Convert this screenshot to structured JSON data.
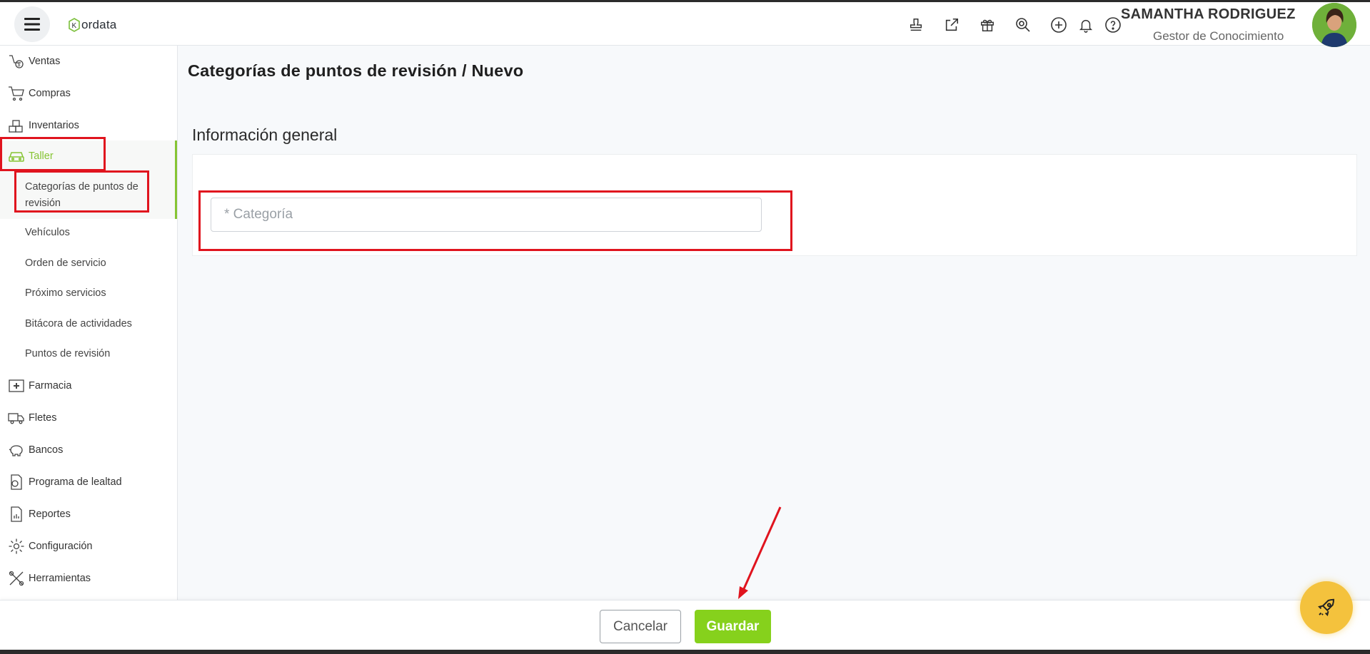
{
  "header": {
    "logo_text": "ordata",
    "logo_mark": "K",
    "icons": [
      "stamp-icon",
      "external-link-icon",
      "gift-icon",
      "search-zoom-icon",
      "plus-circle-icon",
      "bell-icon",
      "help-icon"
    ],
    "user_name": "SAMANTHA RODRIGUEZ",
    "user_role": "Gestor de Conocimiento"
  },
  "sidebar": {
    "items": [
      {
        "label": "Ventas",
        "icon": "sales-icon"
      },
      {
        "label": "Compras",
        "icon": "cart-icon"
      },
      {
        "label": "Inventarios",
        "icon": "boxes-icon"
      },
      {
        "label": "Taller",
        "icon": "car-icon"
      },
      {
        "label": "Farmacia",
        "icon": "pharmacy-icon"
      },
      {
        "label": "Fletes",
        "icon": "truck-icon"
      },
      {
        "label": "Bancos",
        "icon": "piggy-bank-icon"
      },
      {
        "label": "Programa de lealtad",
        "icon": "loyalty-icon"
      },
      {
        "label": "Reportes",
        "icon": "report-icon"
      },
      {
        "label": "Configuración",
        "icon": "gear-icon"
      },
      {
        "label": "Herramientas",
        "icon": "tools-icon"
      }
    ],
    "taller_sub": [
      "Categorías de puntos de revisión",
      "Vehículos",
      "Orden de servicio",
      "Próximo servicios",
      "Bitácora de actividades",
      "Puntos de revisión"
    ],
    "active_color": "#86c433"
  },
  "main": {
    "breadcrumb": "Categorías de puntos de revisión /  Nuevo",
    "section_title": "Información general",
    "category_placeholder": "* Categoría",
    "category_value": ""
  },
  "footer": {
    "cancel_label": "Cancelar",
    "save_label": "Guardar"
  },
  "colors": {
    "brand_green": "#86d11c",
    "highlight_red": "#e0141e",
    "fab_yellow": "#f4c23d"
  }
}
